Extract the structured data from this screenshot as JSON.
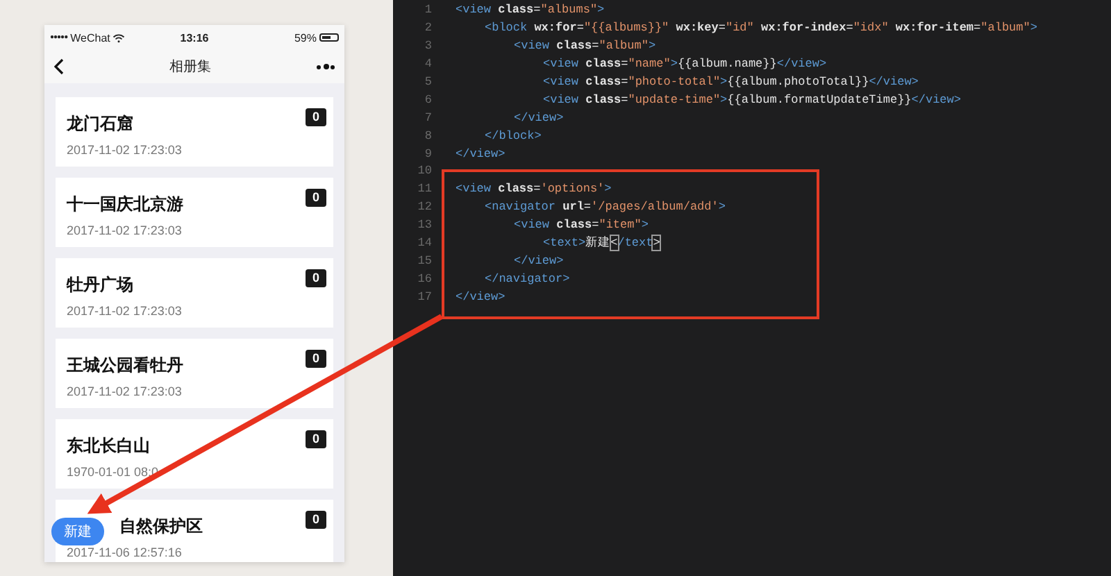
{
  "phone": {
    "status_bar": {
      "signal": "●●●●●",
      "carrier": "WeChat",
      "time": "13:16",
      "battery": "59%"
    },
    "nav_bar": {
      "title": "相册集"
    },
    "albums": [
      {
        "name": "龙门石窟",
        "time": "2017-11-02 17:23:03",
        "count": "0"
      },
      {
        "name": "十一国庆北京游",
        "time": "2017-11-02 17:23:03",
        "count": "0"
      },
      {
        "name": "牡丹广场",
        "time": "2017-11-02 17:23:03",
        "count": "0"
      },
      {
        "name": "王城公园看牡丹",
        "time": "2017-11-02 17:23:03",
        "count": "0"
      },
      {
        "name": "东北长白山",
        "time": "1970-01-01 08:0",
        "count": "0"
      },
      {
        "name": "自然保护区",
        "time": "2017-11-06 12:57:16",
        "count": "0"
      }
    ],
    "new_button": "新建"
  },
  "editor": {
    "lines": [
      {
        "number": "1",
        "tokens": [
          {
            "kind": "tag",
            "text": "<view"
          },
          {
            "kind": "attr",
            "text": " class"
          },
          {
            "kind": "plain",
            "text": "="
          },
          {
            "kind": "str",
            "text": "\"albums\""
          },
          {
            "kind": "tag",
            "text": ">"
          }
        ],
        "children": [
          {
            "number": "2",
            "tokens": [
              {
                "kind": "tag",
                "text": "<block"
              },
              {
                "kind": "attr",
                "text": " wx:for"
              },
              {
                "kind": "plain",
                "text": "="
              },
              {
                "kind": "str",
                "text": "\"{{albums}}\""
              },
              {
                "kind": "attr",
                "text": " wx:key"
              },
              {
                "kind": "plain",
                "text": "="
              },
              {
                "kind": "str",
                "text": "\"id\""
              },
              {
                "kind": "attr",
                "text": " wx:for-index"
              },
              {
                "kind": "plain",
                "text": "="
              },
              {
                "kind": "str",
                "text": "\"idx\""
              },
              {
                "kind": "attr",
                "text": " wx:for-item"
              },
              {
                "kind": "plain",
                "text": "="
              },
              {
                "kind": "str",
                "text": "\"album\""
              },
              {
                "kind": "tag",
                "text": ">"
              }
            ],
            "children": [
              {
                "number": "3",
                "tokens": [
                  {
                    "kind": "tag",
                    "text": "<view"
                  },
                  {
                    "kind": "attr",
                    "text": " class"
                  },
                  {
                    "kind": "plain",
                    "text": "="
                  },
                  {
                    "kind": "str",
                    "text": "\"album\""
                  },
                  {
                    "kind": "tag",
                    "text": ">"
                  }
                ],
                "children": [
                  {
                    "number": "4",
                    "tokens": [
                      {
                        "kind": "tag",
                        "text": "<view"
                      },
                      {
                        "kind": "attr",
                        "text": " class"
                      },
                      {
                        "kind": "plain",
                        "text": "="
                      },
                      {
                        "kind": "str",
                        "text": "\"name\""
                      },
                      {
                        "kind": "tag",
                        "text": ">"
                      },
                      {
                        "kind": "plain",
                        "text": "{{album.name}}"
                      },
                      {
                        "kind": "tag",
                        "text": "</view>"
                      }
                    ]
                  },
                  {
                    "number": "5",
                    "tokens": [
                      {
                        "kind": "tag",
                        "text": "<view"
                      },
                      {
                        "kind": "attr",
                        "text": " class"
                      },
                      {
                        "kind": "plain",
                        "text": "="
                      },
                      {
                        "kind": "str",
                        "text": "\"photo-total\""
                      },
                      {
                        "kind": "tag",
                        "text": ">"
                      },
                      {
                        "kind": "plain",
                        "text": "{{album.photoTotal}}"
                      },
                      {
                        "kind": "tag",
                        "text": "</view>"
                      }
                    ]
                  },
                  {
                    "number": "6",
                    "tokens": [
                      {
                        "kind": "tag",
                        "text": "<view"
                      },
                      {
                        "kind": "attr",
                        "text": " class"
                      },
                      {
                        "kind": "plain",
                        "text": "="
                      },
                      {
                        "kind": "str",
                        "text": "\"update-time\""
                      },
                      {
                        "kind": "tag",
                        "text": ">"
                      },
                      {
                        "kind": "plain",
                        "text": "{{album.formatUpdateTime}}"
                      },
                      {
                        "kind": "tag",
                        "text": "</view>"
                      }
                    ]
                  }
                ]
              },
              {
                "number": "7",
                "tokens": [
                  {
                    "kind": "tag",
                    "text": "</view>"
                  }
                ]
              }
            ]
          },
          {
            "number": "8",
            "tokens": [
              {
                "kind": "tag",
                "text": "</block>"
              }
            ]
          }
        ]
      },
      {
        "number": "9",
        "tokens": [
          {
            "kind": "tag",
            "text": "</view>"
          }
        ]
      },
      {
        "number": "10"
      },
      {
        "number": "11",
        "tokens": [
          {
            "kind": "tag",
            "text": "<view"
          },
          {
            "kind": "attr",
            "text": " class"
          },
          {
            "kind": "plain",
            "text": "="
          },
          {
            "kind": "str",
            "text": "'options'"
          },
          {
            "kind": "tag",
            "text": ">"
          }
        ],
        "children": [
          {
            "number": "12",
            "tokens": [
              {
                "kind": "tag",
                "text": "<navigator"
              },
              {
                "kind": "attr",
                "text": " url"
              },
              {
                "kind": "plain",
                "text": "="
              },
              {
                "kind": "str",
                "text": "'/pages/album/add'"
              },
              {
                "kind": "tag",
                "text": ">"
              }
            ],
            "children": [
              {
                "number": "13",
                "tokens": [
                  {
                    "kind": "tag",
                    "text": "<view"
                  },
                  {
                    "kind": "attr",
                    "text": " class"
                  },
                  {
                    "kind": "plain",
                    "text": "="
                  },
                  {
                    "kind": "str",
                    "text": "\"item\""
                  },
                  {
                    "kind": "tag",
                    "text": ">"
                  }
                ],
                "children": [
                  {
                    "number": "14",
                    "tokens": [
                      {
                        "kind": "tag",
                        "text": "<text>"
                      },
                      {
                        "kind": "plain",
                        "text": "新建"
                      },
                      {
                        "kind": "match",
                        "text": "<"
                      },
                      {
                        "kind": "tag",
                        "text": "/text"
                      },
                      {
                        "kind": "match",
                        "text": ">"
                      }
                    ]
                  }
                ]
              },
              {
                "number": "15",
                "tokens": [
                  {
                    "kind": "tag",
                    "text": "</view>"
                  }
                ]
              }
            ]
          },
          {
            "number": "16",
            "tokens": [
              {
                "kind": "tag",
                "text": "</navigator>"
              }
            ]
          }
        ]
      },
      {
        "number": "17",
        "tokens": [
          {
            "kind": "tag",
            "text": "</view>"
          }
        ]
      }
    ]
  }
}
